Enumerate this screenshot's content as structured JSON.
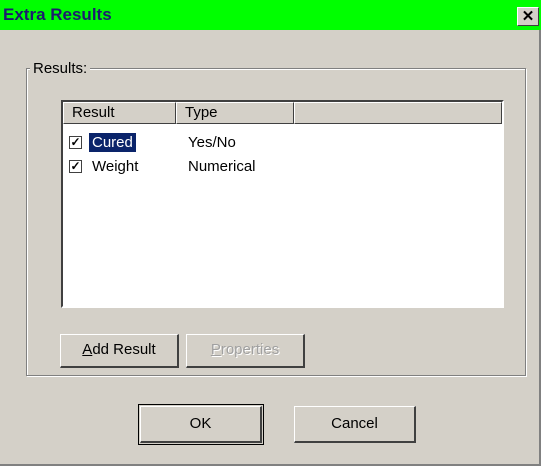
{
  "window": {
    "title": "Extra Results",
    "close_glyph": "✕"
  },
  "group": {
    "label": "Results:"
  },
  "list": {
    "columns": [
      "Result",
      "Type"
    ],
    "rows": [
      {
        "checked": true,
        "check_glyph": "✓",
        "result": "Cured",
        "type": "Yes/No",
        "selected": true
      },
      {
        "checked": true,
        "check_glyph": "✓",
        "result": "Weight",
        "type": "Numerical",
        "selected": false
      }
    ]
  },
  "buttons": {
    "add_result": "Add Result",
    "properties": "Properties",
    "ok": "OK",
    "cancel": "Cancel"
  },
  "colors": {
    "titlebar": "#00ff00",
    "dialog_bg": "#d4d0c8",
    "selection": "#0a246a"
  }
}
